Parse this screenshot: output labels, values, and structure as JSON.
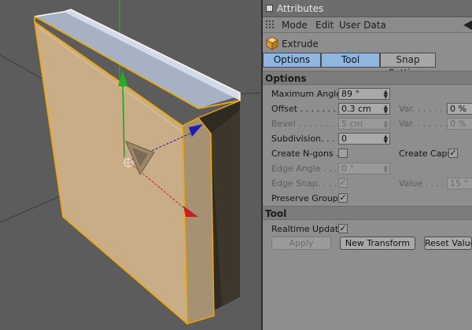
{
  "panel": {
    "title": "Attributes",
    "menu": [
      "Mode",
      "Edit",
      "User Data"
    ],
    "object_name": "Extrude",
    "tabs": [
      {
        "label": "Options",
        "active": true
      },
      {
        "label": "Tool",
        "active": true
      },
      {
        "label": "Snap Settings",
        "active": false
      }
    ]
  },
  "options": {
    "section_title": "Options",
    "max_angle": {
      "label": "Maximum Angle",
      "value": "89 °"
    },
    "offset": {
      "label": "Offset . . . . . . . .",
      "value": "0.3 cm"
    },
    "offset_var": {
      "label": "Var. . . . . . . . .",
      "value": "0 %"
    },
    "bevel": {
      "label": "Bevel . . . . . . . .",
      "value": "5 cm"
    },
    "bevel_var": {
      "label": "Var. . . . . . . . .",
      "value": "0 %"
    },
    "subdivision": {
      "label": "Subdivision. . . .",
      "value": "0"
    },
    "create_ngons": {
      "label": "Create N-gons . .",
      "checked": false
    },
    "create_caps": {
      "label": "Create Caps",
      "checked": true
    },
    "edge_angle": {
      "label": "Edge Angle . . . .",
      "value": "0 °"
    },
    "edge_snap": {
      "label": "Edge Snap. . . . .",
      "checked": true
    },
    "edge_snap_value": {
      "label": "Value . . . . . . .",
      "value": "15 °"
    },
    "preserve_groups": {
      "label": "Preserve Groups",
      "checked": true
    }
  },
  "tool": {
    "section_title": "Tool",
    "realtime_update": {
      "label": "Realtime Update",
      "checked": true
    },
    "apply_label": "Apply",
    "new_transform_label": "New Transform",
    "reset_values_label": "Reset Values"
  },
  "colors": {
    "viewport_bg": "#5c5c5c",
    "object_face": "#c9ae85",
    "object_side": "#2f2a22",
    "selection_edge": "#f0a800",
    "top_face": "#a7b3c6",
    "axis_y": "#1f9e1f",
    "axis_x": "#c21c1c",
    "axis_z": "#1a1a9a",
    "tab_active": "#8fb6dc"
  }
}
